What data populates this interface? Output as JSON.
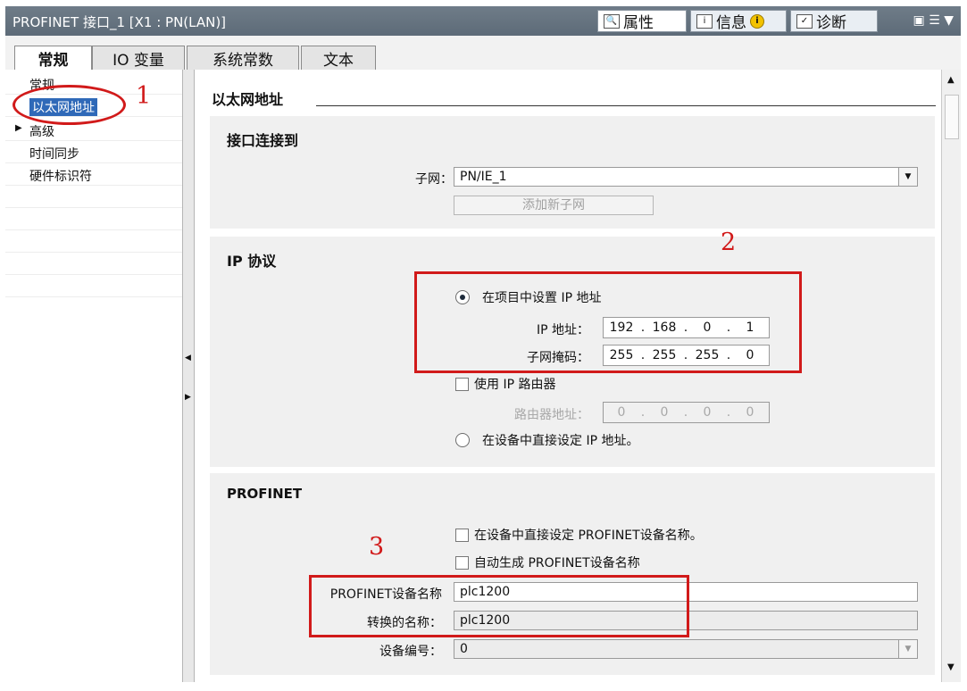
{
  "window": {
    "title": "PROFINET 接口_1 [X1 : PN(LAN)]",
    "panel_tabs": [
      {
        "label": "属性",
        "icon": "properties-icon",
        "active": true
      },
      {
        "label": "信息",
        "icon": "info-icon",
        "badge": "i",
        "active": false
      },
      {
        "label": "诊断",
        "icon": "diagnostics-icon",
        "active": false
      }
    ]
  },
  "main_tabs": [
    {
      "label": "常规",
      "active": true
    },
    {
      "label": "IO 变量",
      "active": false
    },
    {
      "label": "系统常数",
      "active": false
    },
    {
      "label": "文本",
      "active": false
    }
  ],
  "nav": {
    "items": [
      {
        "label": "常规",
        "selected": false,
        "expandable": false
      },
      {
        "label": "以太网地址",
        "selected": true,
        "expandable": false
      },
      {
        "label": "高级",
        "selected": false,
        "expandable": true
      },
      {
        "label": "时间同步",
        "selected": false,
        "expandable": false
      },
      {
        "label": "硬件标识符",
        "selected": false,
        "expandable": false
      }
    ]
  },
  "content": {
    "heading": "以太网地址",
    "interface": {
      "title": "接口连接到",
      "subnet_label": "子网：",
      "subnet_value": "PN/IE_1",
      "add_subnet_button": "添加新子网"
    },
    "ip": {
      "title": "IP 协议",
      "radio_project": "在项目中设置 IP 地址",
      "ip_label": "IP 地址：",
      "ip_octets": [
        "192",
        "168",
        "0",
        "1"
      ],
      "mask_label": "子网掩码：",
      "mask_octets": [
        "255",
        "255",
        "255",
        "0"
      ],
      "router_check": "使用 IP 路由器",
      "router_label": "路由器地址：",
      "router_octets": [
        "0",
        "0",
        "0",
        "0"
      ],
      "radio_device": "在设备中直接设定 IP 地址。"
    },
    "profinet": {
      "title": "PROFINET",
      "check_device_name": "在设备中直接设定 PROFINET设备名称。",
      "check_auto": "自动生成 PROFINET设备名称",
      "name_label": "PROFINET设备名称",
      "name_value": "plc1200",
      "converted_label": "转换的名称：",
      "converted_value": "plc1200",
      "number_label": "设备编号：",
      "number_value": "0"
    }
  },
  "annotations": [
    "1",
    "2",
    "3"
  ],
  "colors": {
    "annotation": "#d11a1a",
    "selection": "#2f69b8",
    "titlebar": "#5d6b78"
  }
}
